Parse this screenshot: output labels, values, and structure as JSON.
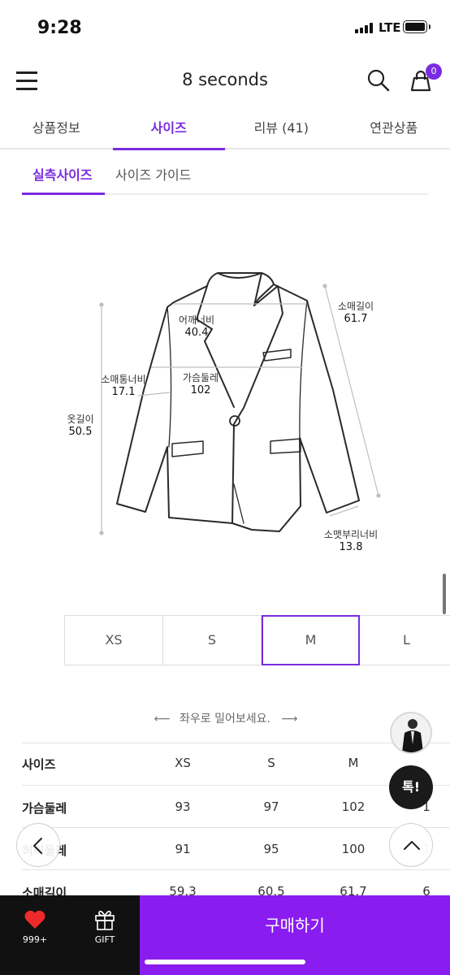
{
  "status_bar": {
    "time": "9:28",
    "network": "LTE"
  },
  "header": {
    "title": "8 seconds",
    "cart_count": "0"
  },
  "tabs": [
    {
      "label": "상품정보",
      "active": false
    },
    {
      "label": "사이즈",
      "active": true
    },
    {
      "label": "리뷰 (41)",
      "active": false
    },
    {
      "label": "연관상품",
      "active": false
    }
  ],
  "subtabs": [
    {
      "label": "실측사이즈",
      "active": true
    },
    {
      "label": "사이즈 가이드",
      "active": false
    }
  ],
  "diagram": {
    "shoulder": {
      "label": "어깨너비",
      "value": "40.4"
    },
    "sleeve_length": {
      "label": "소매길이",
      "value": "61.7"
    },
    "sleeve_width": {
      "label": "소매통너비",
      "value": "17.1"
    },
    "chest": {
      "label": "가슴둘레",
      "value": "102"
    },
    "length": {
      "label": "옷길이",
      "value": "50.5"
    },
    "cuff_width": {
      "label": "소맷부리너비",
      "value": "13.8"
    }
  },
  "sizes": [
    "XS",
    "S",
    "M",
    "L"
  ],
  "selected_size": "M",
  "swipe_hint": "좌우로 밀어보세요.",
  "table": {
    "header": {
      "label": "사이즈",
      "values": [
        "XS",
        "S",
        "M"
      ]
    },
    "rows": [
      {
        "label": "가슴둘레",
        "values": [
          "93",
          "97",
          "102"
        ],
        "partial": "1"
      },
      {
        "label": "허리둘레",
        "values": [
          "91",
          "95",
          "100"
        ],
        "partial": "1"
      },
      {
        "label": "소매길이",
        "values": [
          "59.3",
          "60.5",
          "61.7"
        ],
        "partial": "6"
      }
    ]
  },
  "floating": {
    "talk_label": "톡!"
  },
  "bottom_bar": {
    "wishlist_count": "999+",
    "gift_label": "GIFT",
    "buy_label": "구매하기"
  },
  "colors": {
    "accent": "#7a2be0",
    "buy_button": "#8a1cf0",
    "bar_dark": "#111111"
  }
}
